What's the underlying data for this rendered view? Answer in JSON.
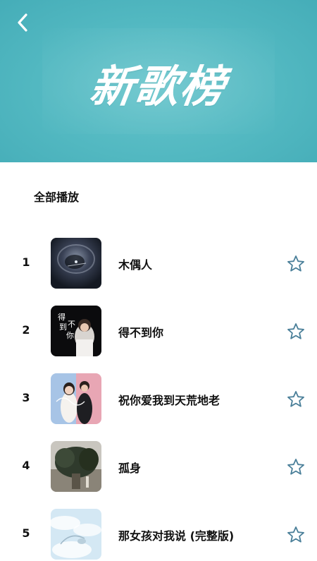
{
  "header": {
    "title": "新歌榜",
    "back_icon": "chevron-left-icon",
    "background_color": "#52b8c1"
  },
  "actions": {
    "play_all_label": "全部播放"
  },
  "songs": [
    {
      "rank": "1",
      "title": "木偶人",
      "cover_icon": "album-cover",
      "favorite_icon": "star-outline-icon"
    },
    {
      "rank": "2",
      "title": "得不到你",
      "cover_icon": "album-cover",
      "cover_text": "得\n到不\n你",
      "favorite_icon": "star-outline-icon"
    },
    {
      "rank": "3",
      "title": "祝你爱我到天荒地老",
      "cover_icon": "album-cover",
      "favorite_icon": "star-outline-icon"
    },
    {
      "rank": "4",
      "title": "孤身",
      "cover_icon": "album-cover",
      "favorite_icon": "star-outline-icon"
    },
    {
      "rank": "5",
      "title": "那女孩对我说 (完整版)",
      "cover_icon": "album-cover",
      "favorite_icon": "star-outline-icon"
    }
  ],
  "colors": {
    "star_stroke": "#4a7f99",
    "text": "#111111"
  }
}
